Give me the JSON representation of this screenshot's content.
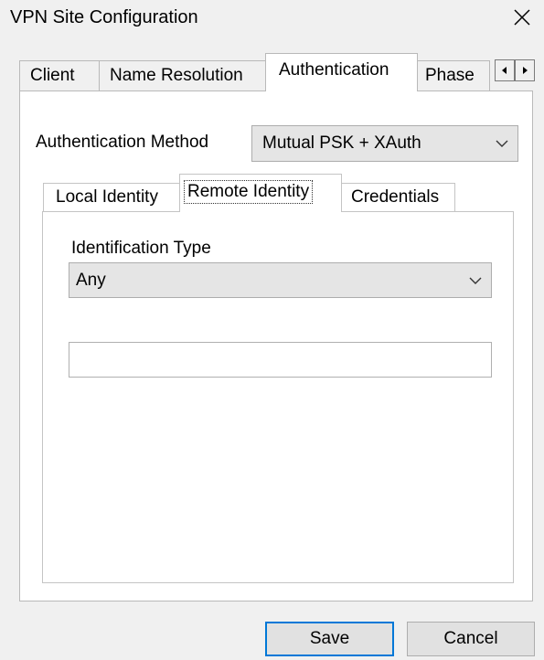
{
  "window": {
    "title": "VPN Site Configuration",
    "close_icon": "close-icon"
  },
  "tabs": [
    {
      "label": "Client",
      "selected": false
    },
    {
      "label": "Name Resolution",
      "selected": false
    },
    {
      "label": "Authentication",
      "selected": true
    },
    {
      "label": "Phase",
      "selected": false
    }
  ],
  "tab_scroll": {
    "left_icon": "triangle-left-icon",
    "right_icon": "triangle-right-icon"
  },
  "authentication": {
    "method_label": "Authentication Method",
    "method_value": "Mutual PSK + XAuth",
    "inner_tabs": [
      {
        "label": "Local Identity",
        "selected": false
      },
      {
        "label": "Remote Identity",
        "selected": true
      },
      {
        "label": "Credentials",
        "selected": false
      }
    ],
    "remote_identity": {
      "type_label": "Identification Type",
      "type_value": "Any",
      "value": ""
    }
  },
  "buttons": {
    "save": "Save",
    "cancel": "Cancel"
  },
  "colors": {
    "window_bg": "#f0f0f0",
    "panel_bg": "#ffffff",
    "default_button_border": "#0078d7",
    "dropdown_bg": "#e5e5e5"
  }
}
